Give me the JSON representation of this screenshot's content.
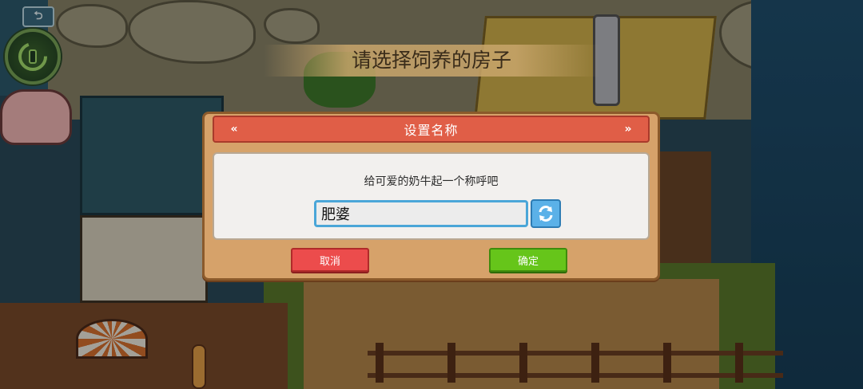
{
  "hud": {
    "back_glyph": "⮌",
    "avatar_icon": "player-avatar"
  },
  "scene": {
    "title": "请选择饲养的房子"
  },
  "dialog": {
    "title": "设置名称",
    "header_chevron_left": "«",
    "header_chevron_right": "»",
    "prompt": "给可爱的奶牛起一个称呼吧",
    "name_value": "肥婆",
    "refresh_icon": "refresh-icon",
    "cancel_label": "取消",
    "confirm_label": "确定"
  },
  "colors": {
    "header_red": "#e05e47",
    "dialog_tan": "#d6a26a",
    "cancel_red": "#ec4c4c",
    "confirm_green": "#66c51a",
    "input_border_blue": "#4aa6d8"
  }
}
